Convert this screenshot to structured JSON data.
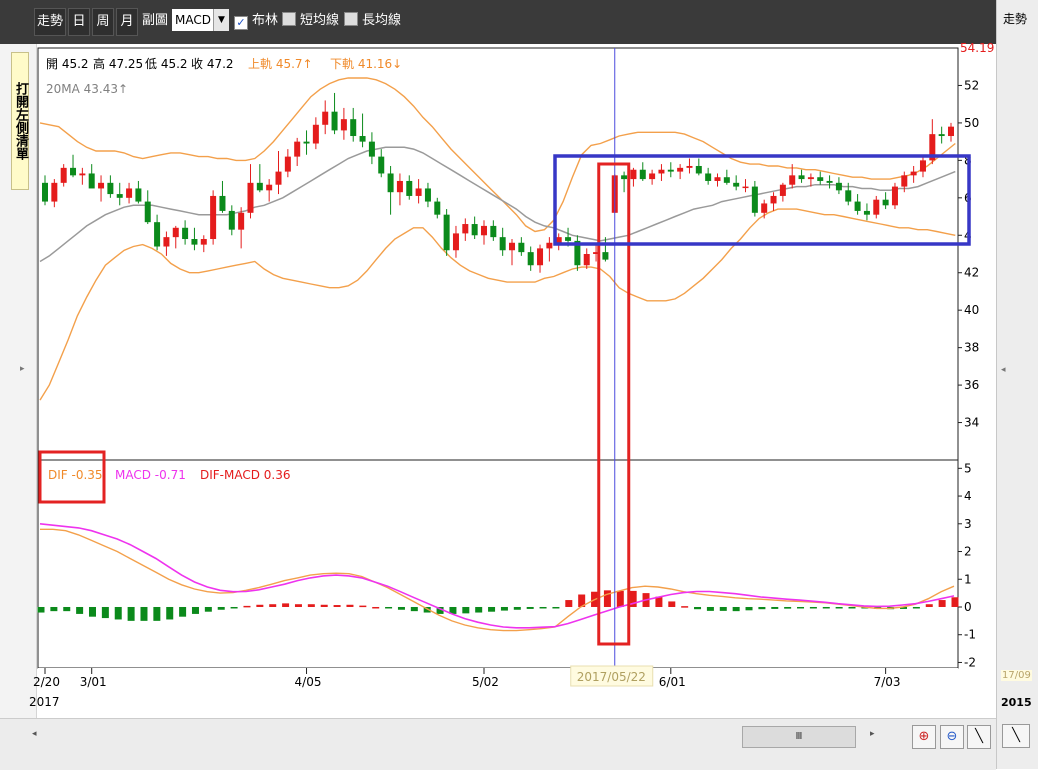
{
  "toolbar": {
    "items": [
      "走勢",
      "日",
      "周",
      "月",
      "副圖"
    ],
    "sub_chart_value": "MACD",
    "checks": [
      {
        "label": "布林",
        "checked": true
      },
      {
        "label": "短均線",
        "checked": false
      },
      {
        "label": "長均線",
        "checked": false
      }
    ]
  },
  "left_tab_label": "打開左側清單",
  "right_panel": {
    "tab": "走勢",
    "date": "17/09",
    "year": "2015"
  },
  "bottom": {
    "scroll_label": "Ⅲ",
    "arrow_left": "◂",
    "arrow_right": "▸"
  },
  "chart_data": {
    "type": "candlestick",
    "colors": {
      "up": "#e41c1c",
      "down": "#0b8a1b",
      "boll_band": "#f3a04b",
      "ma20": "#9a9a9a",
      "dif": "#f3a04b",
      "macd": "#ee33ee",
      "crosshair": "#4a4ade",
      "box_red": "#e32222",
      "box_blue": "#3737c6"
    },
    "ohlc_readout": {
      "open": "開 45.2",
      "high": "高 47.25",
      "low": "低 45.2",
      "close": "收 47.2",
      "upper": "上軌 45.7↑",
      "lower": "下軌 41.16↓",
      "ma20": "20MA 43.43↑"
    },
    "price_max_label": "54.19",
    "price_axis": {
      "min": 32,
      "max": 54,
      "ticks": [
        34,
        36,
        38,
        40,
        42,
        44,
        46,
        48,
        50,
        52
      ],
      "tick_labels": [
        "34",
        "36",
        "38",
        "40",
        "42",
        "4",
        "6",
        "8",
        "50",
        "52"
      ]
    },
    "macd_legend": {
      "dif": "DIF -0.35",
      "macd": "MACD -0.71",
      "diff": "DIF-MACD 0.36"
    },
    "macd_axis": {
      "min": -2.2,
      "max": 5.3,
      "ticks": [
        -2,
        -1,
        0,
        1,
        2,
        3,
        4,
        5
      ],
      "tick_labels": [
        "-2",
        "-1",
        "0",
        "1",
        "2",
        "3",
        "4",
        "5"
      ]
    },
    "x_labels": [
      {
        "i": 0,
        "label": "2/20"
      },
      {
        "i": 5,
        "label": "3/01"
      },
      {
        "i": 28,
        "label": "4/05"
      },
      {
        "i": 47,
        "label": "5/02"
      },
      {
        "i": 67,
        "label": "6/01"
      },
      {
        "i": 90,
        "label": "7/03"
      }
    ],
    "year_label": "2017",
    "selected_date": "2017/05/22",
    "selected_index": 61,
    "ohlc": [
      [
        46.8,
        47.2,
        45.6,
        45.8
      ],
      [
        45.8,
        47.0,
        45.5,
        46.8
      ],
      [
        46.8,
        47.8,
        46.6,
        47.6
      ],
      [
        47.6,
        48.3,
        47.1,
        47.2
      ],
      [
        47.2,
        47.6,
        46.7,
        47.3
      ],
      [
        47.3,
        47.8,
        46.8,
        46.5
      ],
      [
        46.5,
        47.2,
        45.8,
        46.8
      ],
      [
        46.8,
        47.2,
        46.0,
        46.2
      ],
      [
        46.2,
        46.8,
        45.6,
        46.0
      ],
      [
        46.0,
        46.8,
        45.7,
        46.5
      ],
      [
        46.5,
        46.9,
        45.7,
        45.8
      ],
      [
        45.8,
        46.4,
        44.6,
        44.7
      ],
      [
        44.7,
        45.1,
        43.2,
        43.4
      ],
      [
        43.4,
        44.2,
        42.9,
        43.9
      ],
      [
        43.9,
        44.5,
        43.3,
        44.4
      ],
      [
        44.4,
        44.8,
        43.5,
        43.8
      ],
      [
        43.8,
        44.4,
        43.2,
        43.5
      ],
      [
        43.5,
        44.0,
        43.1,
        43.8
      ],
      [
        43.8,
        46.4,
        43.5,
        46.1
      ],
      [
        46.1,
        46.9,
        45.2,
        45.3
      ],
      [
        45.3,
        45.6,
        44.0,
        44.3
      ],
      [
        44.3,
        45.5,
        43.3,
        45.2
      ],
      [
        45.2,
        47.8,
        44.9,
        46.8
      ],
      [
        46.8,
        47.8,
        46.3,
        46.4
      ],
      [
        46.4,
        47.0,
        45.8,
        46.7
      ],
      [
        46.7,
        48.5,
        46.2,
        47.4
      ],
      [
        47.4,
        48.6,
        47.1,
        48.2
      ],
      [
        48.2,
        49.2,
        47.7,
        49.0
      ],
      [
        49.0,
        49.6,
        48.3,
        48.9
      ],
      [
        48.9,
        50.3,
        48.6,
        49.9
      ],
      [
        49.9,
        51.2,
        49.4,
        50.6
      ],
      [
        50.6,
        51.6,
        49.4,
        49.6
      ],
      [
        49.6,
        50.8,
        49.1,
        50.2
      ],
      [
        50.2,
        50.8,
        49.0,
        49.3
      ],
      [
        49.3,
        50.5,
        48.7,
        49.0
      ],
      [
        49.0,
        49.5,
        47.8,
        48.2
      ],
      [
        48.2,
        48.6,
        47.1,
        47.3
      ],
      [
        47.3,
        47.7,
        45.1,
        46.3
      ],
      [
        46.3,
        47.3,
        45.6,
        46.9
      ],
      [
        46.9,
        47.2,
        45.9,
        46.1
      ],
      [
        46.1,
        47.0,
        45.7,
        46.5
      ],
      [
        46.5,
        46.8,
        45.5,
        45.8
      ],
      [
        45.8,
        46.0,
        44.9,
        45.1
      ],
      [
        45.1,
        45.4,
        42.9,
        43.2
      ],
      [
        43.2,
        44.5,
        42.8,
        44.1
      ],
      [
        44.1,
        44.9,
        43.7,
        44.6
      ],
      [
        44.6,
        45.0,
        43.8,
        44.0
      ],
      [
        44.0,
        44.8,
        43.5,
        44.5
      ],
      [
        44.5,
        44.8,
        43.7,
        43.9
      ],
      [
        43.9,
        44.4,
        42.9,
        43.2
      ],
      [
        43.2,
        43.8,
        42.4,
        43.6
      ],
      [
        43.6,
        43.9,
        42.9,
        43.1
      ],
      [
        43.1,
        43.4,
        42.1,
        42.4
      ],
      [
        42.4,
        43.5,
        42.0,
        43.3
      ],
      [
        43.3,
        43.9,
        42.6,
        43.6
      ],
      [
        43.6,
        44.1,
        43.2,
        43.9
      ],
      [
        43.9,
        44.4,
        43.4,
        43.7
      ],
      [
        43.7,
        44.0,
        42.1,
        42.4
      ],
      [
        42.4,
        43.3,
        42.2,
        43.0
      ],
      [
        43.0,
        43.6,
        42.6,
        43.1
      ],
      [
        43.1,
        43.9,
        42.6,
        42.7
      ],
      [
        45.2,
        47.25,
        45.2,
        47.2
      ],
      [
        47.2,
        47.4,
        46.3,
        47.0
      ],
      [
        47.0,
        47.6,
        46.6,
        47.5
      ],
      [
        47.5,
        47.9,
        46.9,
        47.0
      ],
      [
        47.0,
        47.5,
        46.7,
        47.3
      ],
      [
        47.3,
        47.8,
        46.9,
        47.5
      ],
      [
        47.5,
        47.9,
        47.1,
        47.4
      ],
      [
        47.4,
        47.8,
        47.0,
        47.6
      ],
      [
        47.6,
        48.1,
        47.3,
        47.7
      ],
      [
        47.7,
        48.1,
        47.2,
        47.3
      ],
      [
        47.3,
        47.6,
        46.7,
        46.9
      ],
      [
        46.9,
        47.3,
        46.6,
        47.1
      ],
      [
        47.1,
        47.5,
        46.7,
        46.8
      ],
      [
        46.8,
        47.2,
        46.4,
        46.6
      ],
      [
        46.6,
        47.0,
        46.3,
        46.6
      ],
      [
        46.6,
        46.9,
        45.0,
        45.2
      ],
      [
        45.2,
        45.9,
        44.9,
        45.7
      ],
      [
        45.7,
        46.3,
        45.3,
        46.1
      ],
      [
        46.1,
        46.8,
        45.8,
        46.7
      ],
      [
        46.7,
        47.8,
        46.5,
        47.2
      ],
      [
        47.2,
        47.5,
        46.8,
        47.0
      ],
      [
        47.0,
        47.3,
        46.6,
        47.1
      ],
      [
        47.1,
        47.4,
        46.7,
        46.9
      ],
      [
        46.9,
        47.2,
        46.5,
        46.8
      ],
      [
        46.8,
        47.1,
        46.2,
        46.4
      ],
      [
        46.4,
        46.8,
        45.6,
        45.8
      ],
      [
        45.8,
        46.2,
        45.1,
        45.3
      ],
      [
        45.3,
        45.7,
        44.8,
        45.1
      ],
      [
        45.1,
        46.1,
        44.9,
        45.9
      ],
      [
        45.9,
        46.3,
        45.4,
        45.6
      ],
      [
        45.6,
        46.8,
        45.4,
        46.6
      ],
      [
        46.6,
        47.4,
        46.3,
        47.2
      ],
      [
        47.2,
        47.7,
        46.8,
        47.4
      ],
      [
        47.4,
        48.3,
        47.1,
        48.0
      ],
      [
        48.0,
        50.2,
        47.8,
        49.4
      ],
      [
        49.4,
        49.8,
        48.9,
        49.3
      ],
      [
        49.3,
        50.0,
        49.0,
        49.8
      ]
    ],
    "ma20": [
      42.6,
      42.9,
      43.3,
      43.7,
      44.1,
      44.5,
      44.8,
      45.1,
      45.3,
      45.5,
      45.6,
      45.6,
      45.6,
      45.5,
      45.4,
      45.3,
      45.2,
      45.1,
      45.1,
      45.1,
      45.1,
      45.2,
      45.3,
      45.5,
      45.6,
      45.8,
      46.0,
      46.3,
      46.6,
      46.9,
      47.2,
      47.5,
      47.8,
      48.1,
      48.3,
      48.5,
      48.6,
      48.7,
      48.7,
      48.7,
      48.6,
      48.4,
      48.1,
      47.8,
      47.5,
      47.2,
      46.9,
      46.6,
      46.3,
      46.0,
      45.7,
      45.4,
      45.0,
      44.7,
      44.5,
      44.4,
      44.2,
      44.0,
      43.9,
      43.8,
      43.7,
      43.8,
      43.9,
      44.0,
      44.2,
      44.4,
      44.6,
      44.8,
      45.0,
      45.2,
      45.4,
      45.5,
      45.6,
      45.8,
      45.9,
      46.0,
      46.1,
      46.2,
      46.3,
      46.4,
      46.5,
      46.6,
      46.6,
      46.7,
      46.7,
      46.7,
      46.6,
      46.6,
      46.5,
      46.5,
      46.4,
      46.4,
      46.5,
      46.5,
      46.6,
      46.8,
      47.0,
      47.2,
      47.4
    ],
    "boll_upper": [
      50.0,
      49.9,
      49.8,
      49.4,
      49.0,
      48.7,
      48.5,
      48.5,
      48.5,
      48.4,
      48.2,
      48.1,
      48.2,
      48.3,
      48.4,
      48.4,
      48.3,
      48.2,
      48.2,
      48.1,
      48.1,
      48.0,
      48.0,
      48.1,
      48.5,
      49.0,
      49.6,
      50.2,
      50.8,
      51.4,
      51.8,
      52.1,
      52.3,
      52.4,
      52.4,
      52.4,
      52.3,
      52.1,
      51.8,
      51.4,
      50.9,
      50.3,
      49.8,
      49.2,
      48.6,
      48.1,
      47.6,
      47.1,
      46.6,
      46.1,
      45.6,
      45.1,
      44.5,
      44.2,
      44.3,
      44.8,
      45.8,
      47.1,
      48.3,
      48.8,
      48.9,
      49.1,
      49.3,
      49.4,
      49.5,
      49.5,
      49.5,
      49.5,
      49.5,
      49.4,
      49.2,
      49.0,
      48.7,
      48.4,
      48.1,
      47.9,
      47.8,
      47.8,
      47.7,
      47.7,
      47.6,
      47.6,
      47.5,
      47.5,
      47.4,
      47.3,
      47.2,
      47.1,
      47.1,
      47.0,
      47.0,
      47.0,
      47.1,
      47.2,
      47.4,
      47.7,
      48.1,
      48.5,
      48.9
    ],
    "boll_lower": [
      35.2,
      36.0,
      37.2,
      38.4,
      39.7,
      40.7,
      41.6,
      42.4,
      42.8,
      43.2,
      43.4,
      43.5,
      43.3,
      43.0,
      42.5,
      42.2,
      42.0,
      42.0,
      42.1,
      42.2,
      42.3,
      42.4,
      42.5,
      42.6,
      42.2,
      41.9,
      41.7,
      41.6,
      41.5,
      41.4,
      41.3,
      41.2,
      41.2,
      41.3,
      41.6,
      42.1,
      42.7,
      43.3,
      43.8,
      44.1,
      44.4,
      44.4,
      43.9,
      43.3,
      42.8,
      42.4,
      42.1,
      41.9,
      41.7,
      41.6,
      41.5,
      41.5,
      41.5,
      41.5,
      41.7,
      41.8,
      42.0,
      42.2,
      42.3,
      42.3,
      42.2,
      41.8,
      41.2,
      40.9,
      40.7,
      40.5,
      40.5,
      40.5,
      40.6,
      40.9,
      41.3,
      41.7,
      42.2,
      42.7,
      43.3,
      43.8,
      44.4,
      44.9,
      45.2,
      45.4,
      45.4,
      45.4,
      45.3,
      45.2,
      45.1,
      45.1,
      45.0,
      44.9,
      44.8,
      44.7,
      44.6,
      44.5,
      44.4,
      44.4,
      44.3,
      44.3,
      44.2,
      44.1,
      44.0
    ],
    "dif": [
      2.8,
      2.8,
      2.75,
      2.6,
      2.4,
      2.2,
      2.0,
      1.75,
      1.5,
      1.25,
      1.0,
      0.8,
      0.65,
      0.55,
      0.5,
      0.52,
      0.6,
      0.7,
      0.82,
      0.95,
      1.05,
      1.15,
      1.2,
      1.22,
      1.2,
      1.1,
      0.9,
      0.7,
      0.45,
      0.2,
      -0.05,
      -0.3,
      -0.5,
      -0.65,
      -0.75,
      -0.82,
      -0.85,
      -0.85,
      -0.82,
      -0.78,
      -0.72,
      -0.35,
      0.0,
      0.25,
      0.45,
      0.58,
      0.7,
      0.75,
      0.72,
      0.65,
      0.55,
      0.48,
      0.42,
      0.38,
      0.33,
      0.3,
      0.28,
      0.25,
      0.22,
      0.2,
      0.18,
      0.15,
      0.1,
      0.05,
      0.0,
      -0.05,
      -0.05,
      0.0,
      0.1,
      0.3,
      0.55,
      0.75
    ],
    "macd": [
      3.0,
      2.95,
      2.9,
      2.85,
      2.75,
      2.6,
      2.45,
      2.25,
      2.0,
      1.75,
      1.45,
      1.15,
      0.9,
      0.72,
      0.6,
      0.55,
      0.56,
      0.62,
      0.72,
      0.82,
      0.95,
      1.05,
      1.12,
      1.15,
      1.12,
      1.05,
      0.9,
      0.75,
      0.55,
      0.35,
      0.15,
      -0.05,
      -0.25,
      -0.42,
      -0.55,
      -0.65,
      -0.72,
      -0.75,
      -0.75,
      -0.73,
      -0.71,
      -0.6,
      -0.45,
      -0.3,
      -0.15,
      0.0,
      0.12,
      0.25,
      0.35,
      0.45,
      0.52,
      0.56,
      0.56,
      0.52,
      0.48,
      0.42,
      0.36,
      0.32,
      0.28,
      0.25,
      0.21,
      0.17,
      0.12,
      0.08,
      0.04,
      0.02,
      0.03,
      0.07,
      0.12,
      0.2,
      0.3,
      0.4
    ]
  }
}
